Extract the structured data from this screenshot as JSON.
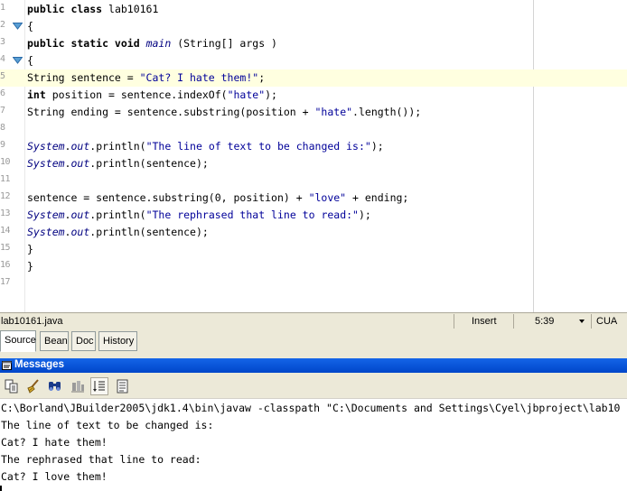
{
  "editor": {
    "lines": [
      {
        "n": "1",
        "tokens": [
          {
            "t": "public class ",
            "c": "kw2"
          },
          {
            "t": "lab10161",
            "c": "plain"
          }
        ]
      },
      {
        "n": "2",
        "tokens": [
          {
            "t": "{",
            "c": "plain"
          }
        ]
      },
      {
        "n": "3",
        "tokens": [
          {
            "t": "public static void ",
            "c": "kw2"
          },
          {
            "t": "main",
            "c": "it"
          },
          {
            "t": " (String[] args )",
            "c": "plain"
          }
        ]
      },
      {
        "n": "4",
        "tokens": [
          {
            "t": "{",
            "c": "plain"
          }
        ]
      },
      {
        "n": "5",
        "tokens": [
          {
            "t": "String sentence = ",
            "c": "plain"
          },
          {
            "t": "\"Cat? I hate them!\"",
            "c": "str"
          },
          {
            "t": ";",
            "c": "plain"
          }
        ]
      },
      {
        "n": "6",
        "tokens": [
          {
            "t": "int",
            "c": "kw2"
          },
          {
            "t": " position = sentence.indexOf(",
            "c": "plain"
          },
          {
            "t": "\"hate\"",
            "c": "str"
          },
          {
            "t": ");",
            "c": "plain"
          }
        ]
      },
      {
        "n": "7",
        "tokens": [
          {
            "t": "String ending = sentence.substring(position + ",
            "c": "plain"
          },
          {
            "t": "\"hate\"",
            "c": "str"
          },
          {
            "t": ".length());",
            "c": "plain"
          }
        ]
      },
      {
        "n": "8",
        "tokens": []
      },
      {
        "n": "9",
        "tokens": [
          {
            "t": "System",
            "c": "it"
          },
          {
            "t": ".",
            "c": "plain"
          },
          {
            "t": "out",
            "c": "it"
          },
          {
            "t": ".println(",
            "c": "plain"
          },
          {
            "t": "\"The line of text to be changed is:\"",
            "c": "str"
          },
          {
            "t": ");",
            "c": "plain"
          }
        ]
      },
      {
        "n": "10",
        "tokens": [
          {
            "t": "System",
            "c": "it"
          },
          {
            "t": ".",
            "c": "plain"
          },
          {
            "t": "out",
            "c": "it"
          },
          {
            "t": ".println(sentence);",
            "c": "plain"
          }
        ]
      },
      {
        "n": "11",
        "tokens": []
      },
      {
        "n": "12",
        "tokens": [
          {
            "t": "sentence = sentence.substring(0, position) + ",
            "c": "plain"
          },
          {
            "t": "\"love\"",
            "c": "str"
          },
          {
            "t": " + ending;",
            "c": "plain"
          }
        ]
      },
      {
        "n": "13",
        "tokens": [
          {
            "t": "System",
            "c": "it"
          },
          {
            "t": ".",
            "c": "plain"
          },
          {
            "t": "out",
            "c": "it"
          },
          {
            "t": ".println(",
            "c": "plain"
          },
          {
            "t": "\"The rephrased that line to read:\"",
            "c": "str"
          },
          {
            "t": ");",
            "c": "plain"
          }
        ]
      },
      {
        "n": "14",
        "tokens": [
          {
            "t": "System",
            "c": "it"
          },
          {
            "t": ".",
            "c": "plain"
          },
          {
            "t": "out",
            "c": "it"
          },
          {
            "t": ".println(sentence);",
            "c": "plain"
          }
        ]
      },
      {
        "n": "15",
        "tokens": [
          {
            "t": "}",
            "c": "plain"
          }
        ]
      },
      {
        "n": "16",
        "tokens": [
          {
            "t": "}",
            "c": "plain"
          }
        ]
      },
      {
        "n": "17",
        "tokens": []
      }
    ],
    "current_line": "5",
    "fold_lines": [
      "2",
      "4"
    ]
  },
  "status_bar": {
    "file_name": "lab10161.java",
    "mode": "Insert",
    "cursor_position": "5:39",
    "encoding": "CUA"
  },
  "tabs": [
    {
      "label": "Source",
      "active": true
    },
    {
      "label": "Bean",
      "active": false
    },
    {
      "label": "Doc",
      "active": false
    },
    {
      "label": "History",
      "active": false
    }
  ],
  "messages": {
    "title": "Messages",
    "toolbar": [
      "copy-icon",
      "clear-icon",
      "find-icon",
      "stop-icon",
      "sort-icon",
      "properties-icon"
    ],
    "console_lines": [
      "C:\\Borland\\JBuilder2005\\jdk1.4\\bin\\javaw -classpath \"C:\\Documents and Settings\\Cyel\\jbproject\\lab10",
      "The line of text to be changed is:",
      "Cat? I hate them!",
      "The rephrased that line to read:",
      "Cat? I love them!"
    ]
  },
  "colors": {
    "title_bar": "#0054e3",
    "current_line": "#ffffe0",
    "string": "#000099",
    "keyword": "#000000",
    "panel": "#ece9d8"
  }
}
